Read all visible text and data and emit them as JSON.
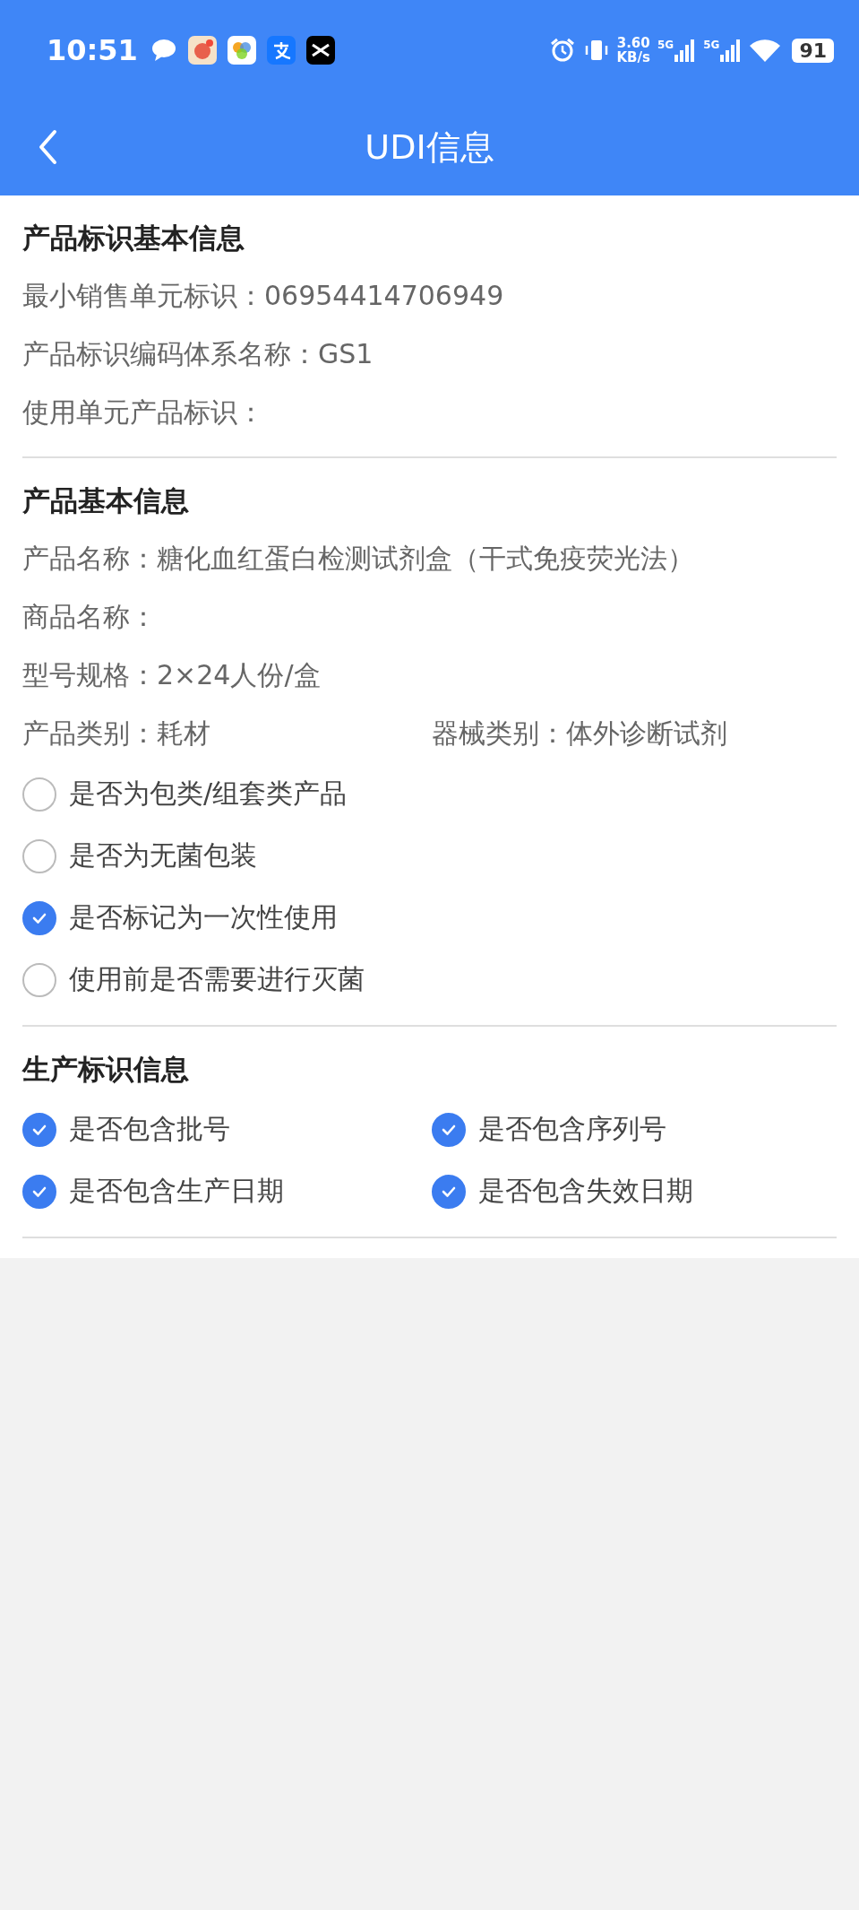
{
  "status_bar": {
    "time": "10:51",
    "net_speed": [
      "3.60",
      "KB/s"
    ],
    "signals": [
      "5G",
      "5G"
    ],
    "battery": "91"
  },
  "header": {
    "title": "UDI信息"
  },
  "sections": [
    {
      "title": "产品标识基本信息",
      "rows": [
        {
          "kind": "text",
          "items": [
            {
              "text": "最小销售单元标识：06954414706949"
            }
          ]
        },
        {
          "kind": "text",
          "items": [
            {
              "text": "产品标识编码体系名称：GS1"
            }
          ]
        },
        {
          "kind": "text",
          "items": [
            {
              "text": "使用单元产品标识："
            }
          ]
        }
      ]
    },
    {
      "title": "产品基本信息",
      "rows": [
        {
          "kind": "text",
          "items": [
            {
              "text": "产品名称：糖化血红蛋白检测试剂盒（干式免疫荧光法）"
            }
          ]
        },
        {
          "kind": "text",
          "items": [
            {
              "text": "商品名称："
            }
          ]
        },
        {
          "kind": "text",
          "items": [
            {
              "text": "型号规格：2×24人份/盒"
            }
          ]
        },
        {
          "kind": "text",
          "items": [
            {
              "text": "产品类别：耗材"
            },
            {
              "text": "器械类别：体外诊断试剂"
            }
          ]
        },
        {
          "kind": "check",
          "items": [
            {
              "text": "是否为包类/组套类产品",
              "checked": false
            }
          ]
        },
        {
          "kind": "check",
          "items": [
            {
              "text": "是否为无菌包装",
              "checked": false
            }
          ]
        },
        {
          "kind": "check",
          "items": [
            {
              "text": "是否标记为一次性使用",
              "checked": true
            }
          ]
        },
        {
          "kind": "check",
          "items": [
            {
              "text": "使用前是否需要进行灭菌",
              "checked": false
            }
          ]
        }
      ]
    },
    {
      "title": "生产标识信息",
      "rows": [
        {
          "kind": "check",
          "items": [
            {
              "text": "是否包含批号",
              "checked": true
            },
            {
              "text": "是否包含序列号",
              "checked": true
            }
          ]
        },
        {
          "kind": "check",
          "items": [
            {
              "text": "是否包含生产日期",
              "checked": true
            },
            {
              "text": "是否包含失效日期",
              "checked": true
            }
          ]
        }
      ]
    }
  ]
}
